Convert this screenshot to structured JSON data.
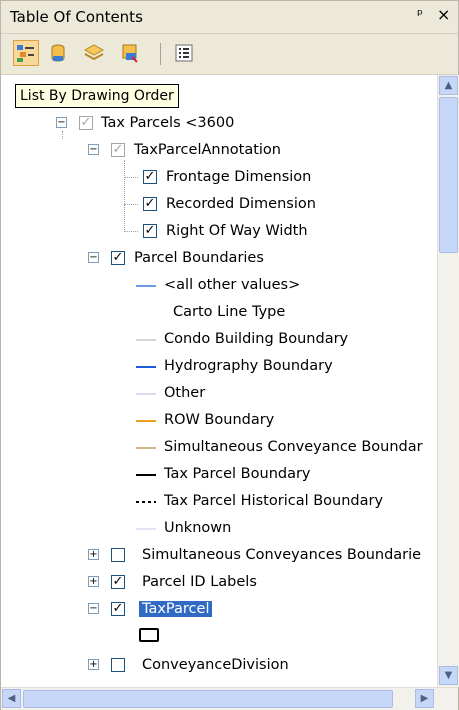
{
  "window": {
    "title": "Table Of Contents",
    "pin_glyph": "ᵖ",
    "close_glyph": "×"
  },
  "toolbar": {
    "buttons": [
      {
        "name": "list-by-drawing-order",
        "icon": "list-drawing-order-icon",
        "active": true
      },
      {
        "name": "list-by-source",
        "icon": "database-icon",
        "active": false
      },
      {
        "name": "list-by-visibility",
        "icon": "layers-icon",
        "active": false
      },
      {
        "name": "list-by-selection",
        "icon": "selection-icon",
        "active": false
      },
      {
        "name": "options",
        "icon": "options-icon",
        "active": false
      }
    ],
    "tooltip": "List By Drawing Order"
  },
  "tree": {
    "tax_parcels_group": "Tax Parcels <3600",
    "annotation_group": "TaxParcelAnnotation",
    "annotation_classes": [
      "Frontage Dimension",
      "Recorded Dimension",
      "Right Of Way Width"
    ],
    "parcel_boundaries": "Parcel Boundaries",
    "all_other_values": "<all other values>",
    "carto_heading": "Carto Line Type",
    "legend": [
      {
        "label": "Condo Building Boundary",
        "color": "#a8a8a8",
        "style": "solid",
        "weight": 1
      },
      {
        "label": "Hydrography Boundary",
        "color": "#1f5bd4",
        "style": "solid",
        "weight": 2
      },
      {
        "label": "Other",
        "color": "#b4b9e6",
        "style": "solid",
        "weight": 1
      },
      {
        "label": "ROW Boundary",
        "color": "#f0a020",
        "style": "solid",
        "weight": 2
      },
      {
        "label": "Simultaneous Conveyance Boundar",
        "color": "#d2b48c",
        "style": "solid",
        "weight": 2
      },
      {
        "label": "Tax Parcel Boundary",
        "color": "#000000",
        "style": "solid",
        "weight": 2
      },
      {
        "label": "Tax Parcel Historical Boundary",
        "color": "#000000",
        "style": "dotted",
        "weight": 2
      },
      {
        "label": "Unknown",
        "color": "#c8c8e8",
        "style": "solid",
        "weight": 1
      }
    ],
    "all_other_values_color": "#6f9ae8",
    "simul_layer": "Simultaneous Conveyances Boundarie",
    "parcel_id_labels": "Parcel ID Labels",
    "tax_parcel": "TaxParcel",
    "conveyance_division": "ConveyanceDivision"
  }
}
